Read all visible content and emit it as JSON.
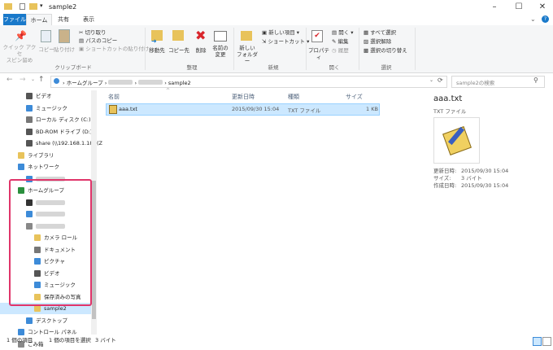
{
  "window": {
    "title": "sample2"
  },
  "tabs": {
    "file": "ファイル",
    "home": "ホーム",
    "share": "共有",
    "view": "表示"
  },
  "ribbon": {
    "clipboard": {
      "pin": "クイック アクセ\nスピン留め",
      "copy": "コピー",
      "paste": "貼り付け",
      "cut": "切り取り",
      "copy_path": "パスのコピー",
      "paste_shortcut": "ショートカットの貼り付け",
      "label": "クリップボード"
    },
    "organize": {
      "move_to": "移動先",
      "copy_to": "コピー先",
      "delete": "削除",
      "rename": "名前の\n変更",
      "label": "整理"
    },
    "new": {
      "new_folder": "新しい\nフォルダー",
      "new_item": "新しい項目",
      "shortcut": "ショートカット",
      "label": "新規"
    },
    "open": {
      "properties": "プロパティ",
      "open": "開く",
      "edit": "編集",
      "history": "履歴",
      "label": "開く"
    },
    "select": {
      "select_all": "すべて選択",
      "select_none": "選択解除",
      "invert": "選択の切り替え",
      "label": "選択"
    }
  },
  "address": {
    "crumbs": [
      "ホームグループ",
      "sample2"
    ],
    "search_placeholder": "sample2の検索"
  },
  "nav": {
    "items": [
      {
        "label": "ビデオ",
        "icon": "video-icon"
      },
      {
        "label": "ミュージック",
        "icon": "music-icon"
      },
      {
        "label": "ローカル ディスク (C:)",
        "icon": "drive-icon"
      },
      {
        "label": "BD-ROM ドライブ (D:)",
        "icon": "disc-icon"
      },
      {
        "label": "share (\\\\192.168.1.18) (Z",
        "icon": "network-drive-icon"
      },
      {
        "label": "ライブラリ",
        "icon": "library-icon"
      },
      {
        "label": "ネットワーク",
        "icon": "network-icon"
      },
      {
        "label": "",
        "icon": "computer-icon"
      },
      {
        "label": "ホームグループ",
        "icon": "homegroup-icon"
      },
      {
        "label": "",
        "icon": "user-icon"
      },
      {
        "label": "",
        "icon": "computer-icon"
      },
      {
        "label": "",
        "icon": "usb-icon"
      },
      {
        "label": "カメラ ロール",
        "icon": "folder-icon"
      },
      {
        "label": "ドキュメント",
        "icon": "documents-icon"
      },
      {
        "label": "ピクチャ",
        "icon": "pictures-icon"
      },
      {
        "label": "ビデオ",
        "icon": "video-icon"
      },
      {
        "label": "ミュージック",
        "icon": "music-icon"
      },
      {
        "label": "保存済みの写真",
        "icon": "folder-icon"
      },
      {
        "label": "sample2",
        "icon": "folder-icon"
      },
      {
        "label": "デスクトップ",
        "icon": "desktop-icon"
      },
      {
        "label": "コントロール パネル",
        "icon": "control-panel-icon"
      },
      {
        "label": "ごみ箱",
        "icon": "recycle-bin-icon"
      }
    ]
  },
  "columns": {
    "name": "名前",
    "date": "更新日時",
    "type": "種類",
    "size": "サイズ"
  },
  "files": [
    {
      "name": "aaa.txt",
      "date": "2015/09/30 15:04",
      "type": "TXT ファイル",
      "size": "1 KB"
    }
  ],
  "preview": {
    "filename": "aaa.txt",
    "filetype": "TXT ファイル",
    "props": [
      {
        "k": "更新日時:",
        "v": "2015/09/30 15:04"
      },
      {
        "k": "サイズ:",
        "v": "3 バイト"
      },
      {
        "k": "作成日時:",
        "v": "2015/09/30 15:04"
      }
    ]
  },
  "status": {
    "count": "1 個の項目",
    "selection": "1 個の項目を選択",
    "size": "3 バイト"
  },
  "colors": {
    "accent": "#1979ca",
    "selection": "#cce8ff",
    "highlight": "#e0356a"
  }
}
